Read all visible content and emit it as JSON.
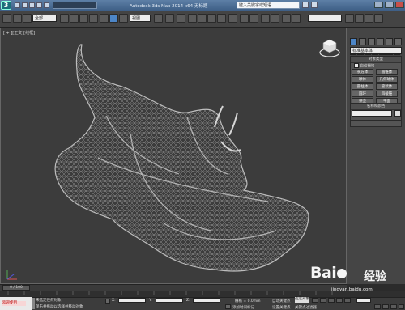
{
  "window": {
    "title": "Autodesk 3ds Max  2014 x64  无标题",
    "search_placeholder": "键入关键字或短语"
  },
  "toolbar": {
    "selection_filter": "全部",
    "reference_coord": "视图",
    "named_selection": "创建选择集"
  },
  "viewport": {
    "label": "[ + ][正交][线框]"
  },
  "command_panel": {
    "category_dropdown": "标准基本体",
    "object_type_title": "对象类型",
    "autogrid_label": "自动栅格",
    "object_buttons": [
      "长方体",
      "圆锥体",
      "球体",
      "几何球体",
      "圆柱体",
      "管状体",
      "圆环",
      "四棱锥",
      "茶壶",
      "平面"
    ],
    "name_color_title": "名称和颜色"
  },
  "timeline": {
    "frame_label": "0 / 100"
  },
  "status": {
    "maxscript_label": "欢迎使用",
    "line1": "未选定任何对象",
    "line2": "单击并拖动以选择并移动对象",
    "grid": "栅格 = 0.0mm",
    "auto_key": "自动关键点",
    "set_key": "设置关键点",
    "selected": "选定对象",
    "key_filters": "关键点过滤器...",
    "add_time_tag": "添加时间标记"
  },
  "watermark": {
    "brand": "Bai",
    "brand_word": "经验",
    "url": "jingyan.baidu.com"
  }
}
